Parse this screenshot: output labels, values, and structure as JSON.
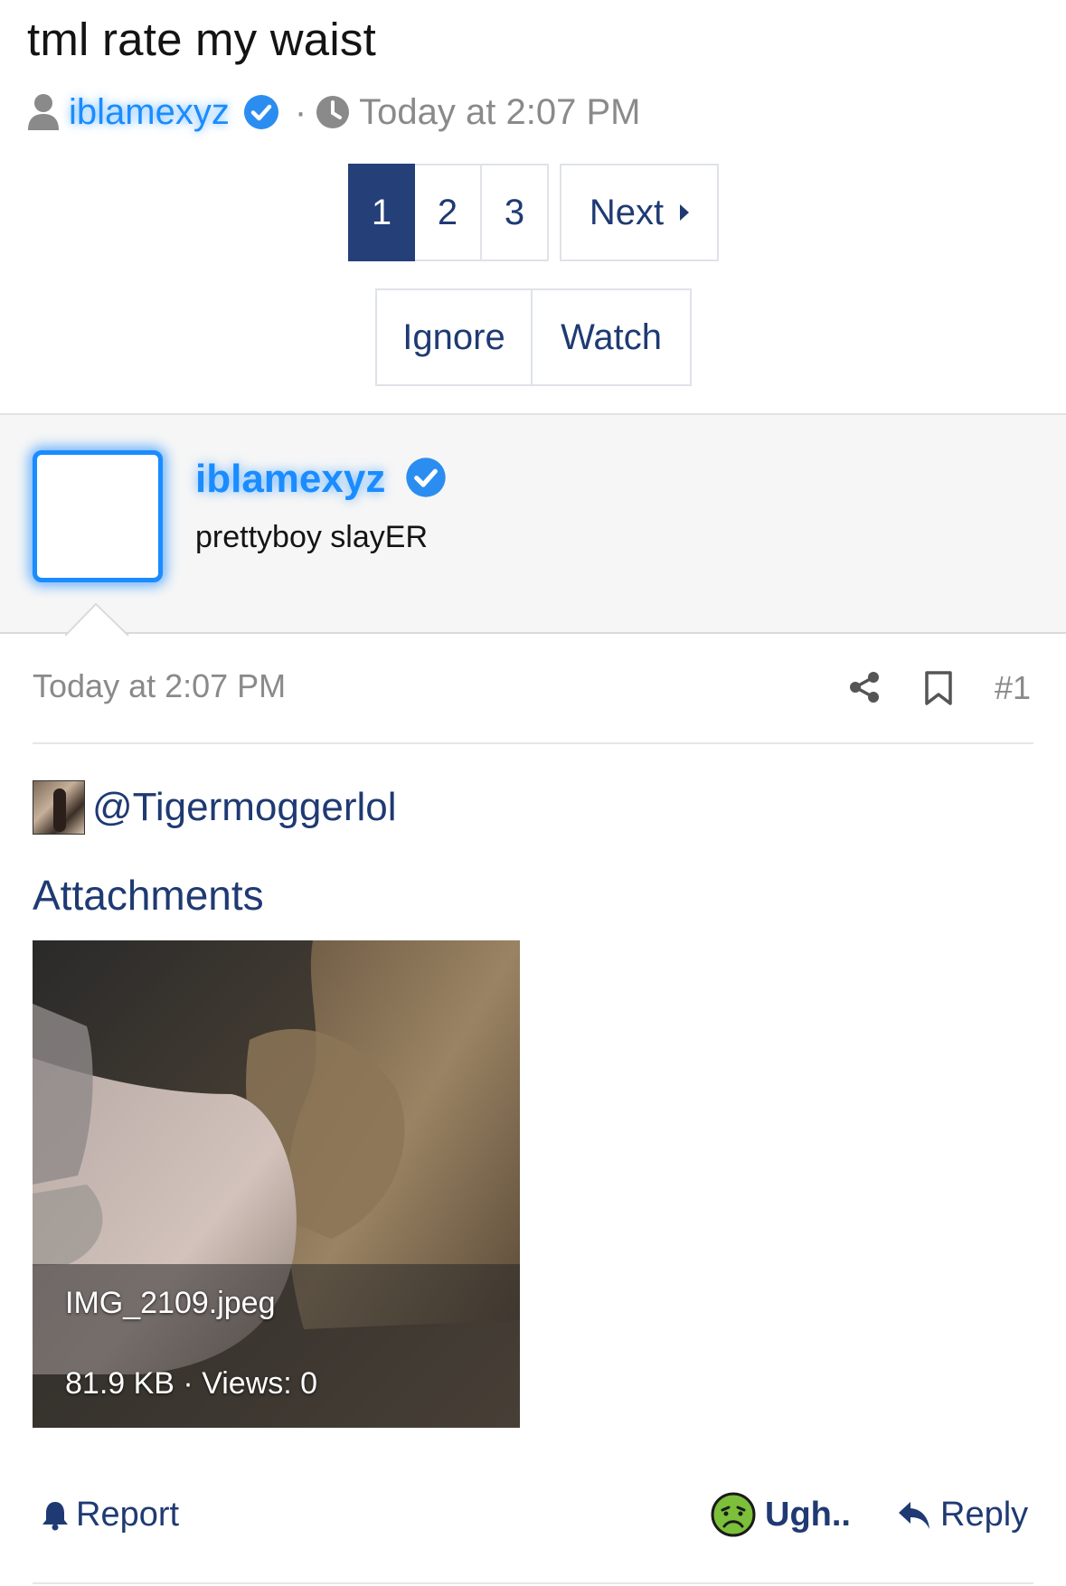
{
  "thread": {
    "title": "tml rate my waist",
    "author": "iblamexyz",
    "time": "Today at 2:07 PM",
    "separator": "·"
  },
  "pagination": {
    "pages": [
      "1",
      "2",
      "3"
    ],
    "active": "1",
    "next_label": "Next"
  },
  "actions": {
    "ignore_label": "Ignore",
    "watch_label": "Watch"
  },
  "post": {
    "username": "iblamexyz",
    "user_title": "prettyboy slayER",
    "date": "Today at 2:07 PM",
    "number": "#1",
    "mention": "@Tigermoggerlol",
    "attachments_heading": "Attachments",
    "attachment": {
      "filename": "IMG_2109.jpeg",
      "meta": "81.9 KB · Views: 0"
    }
  },
  "footer": {
    "report_label": "Report",
    "reaction_label": "Ugh..",
    "reply_label": "Reply"
  },
  "icons": [
    "user-icon",
    "verified-badge-icon",
    "clock-icon",
    "caret-right-icon",
    "share-icon",
    "bookmark-icon",
    "bell-icon",
    "sick-face-emoji-icon",
    "reply-arrow-icon"
  ],
  "colors": {
    "link": "#1f3a73",
    "active_page": "#253f79",
    "username_glow": "#1a8cff",
    "muted": "#8a8a8a"
  }
}
